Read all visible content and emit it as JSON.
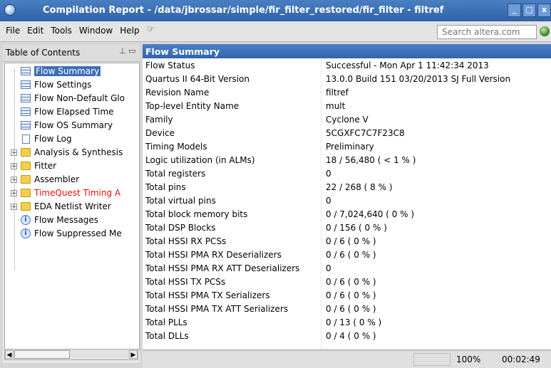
{
  "window": {
    "title": "Compilation Report - /data/jbrossar/simple/fir_filter_restored/fir_filter - filtref",
    "buttons": [
      "minimize",
      "maximize",
      "close"
    ]
  },
  "menubar": {
    "items": [
      "File",
      "Edit",
      "Tools",
      "Window",
      "Help"
    ],
    "search_placeholder": "Search altera.com"
  },
  "toc": {
    "title": "Table of Contents",
    "items": [
      {
        "label": "Flow Summary",
        "icon": "table-icon",
        "selected": true
      },
      {
        "label": "Flow Settings",
        "icon": "table-icon"
      },
      {
        "label": "Flow Non-Default Glo",
        "icon": "table-icon"
      },
      {
        "label": "Flow Elapsed Time",
        "icon": "table-icon"
      },
      {
        "label": "Flow OS Summary",
        "icon": "table-icon"
      },
      {
        "label": "Flow Log",
        "icon": "document-icon"
      },
      {
        "label": "Analysis & Synthesis",
        "icon": "folder-icon",
        "expandable": true
      },
      {
        "label": "Fitter",
        "icon": "folder-icon",
        "expandable": true
      },
      {
        "label": "Assembler",
        "icon": "folder-icon",
        "expandable": true
      },
      {
        "label": "TimeQuest Timing A",
        "icon": "folder-icon",
        "expandable": true,
        "color": "#e01010"
      },
      {
        "label": "EDA Netlist Writer",
        "icon": "folder-icon",
        "expandable": true
      },
      {
        "label": "Flow Messages",
        "icon": "info-icon"
      },
      {
        "label": "Flow Suppressed Me",
        "icon": "info-icon"
      }
    ]
  },
  "report": {
    "title": "Flow Summary",
    "rows": [
      {
        "key": "Flow Status",
        "value": "Successful - Mon Apr  1 11:42:34 2013"
      },
      {
        "key": "Quartus II 64-Bit Version",
        "value": "13.0.0 Build 151 03/20/2013 SJ Full Version"
      },
      {
        "key": "Revision Name",
        "value": "filtref"
      },
      {
        "key": "Top-level Entity Name",
        "value": "mult"
      },
      {
        "key": "Family",
        "value": "Cyclone V"
      },
      {
        "key": "Device",
        "value": "5CGXFC7C7F23C8"
      },
      {
        "key": "Timing Models",
        "value": "Preliminary"
      },
      {
        "key": "Logic utilization (in ALMs)",
        "value": "18 / 56,480 ( < 1 % )"
      },
      {
        "key": "Total registers",
        "value": "0"
      },
      {
        "key": "Total pins",
        "value": "22 / 268 ( 8 % )"
      },
      {
        "key": "Total virtual pins",
        "value": "0"
      },
      {
        "key": "Total block memory bits",
        "value": "0 / 7,024,640 ( 0 % )"
      },
      {
        "key": "Total DSP Blocks",
        "value": "0 / 156 ( 0 % )"
      },
      {
        "key": "Total HSSI RX PCSs",
        "value": "0 / 6 ( 0 % )"
      },
      {
        "key": "Total HSSI PMA RX Deserializers",
        "value": "0 / 6 ( 0 % )"
      },
      {
        "key": "Total HSSI PMA RX ATT Deserializers",
        "value": "0"
      },
      {
        "key": "Total HSSI TX PCSs",
        "value": "0 / 6 ( 0 % )"
      },
      {
        "key": "Total HSSI PMA TX Serializers",
        "value": "0 / 6 ( 0 % )"
      },
      {
        "key": "Total HSSI PMA TX ATT Serializers",
        "value": "0 / 6 ( 0 % )"
      },
      {
        "key": "Total PLLs",
        "value": "0 / 13 ( 0 % )"
      },
      {
        "key": "Total DLLs",
        "value": "0 / 4 ( 0 % )"
      }
    ]
  },
  "status": {
    "zoom": "100%",
    "elapsed": "00:02:49"
  },
  "colors": {
    "title_bar": "#3d6fb8",
    "selection": "#3d6fb8",
    "warning_text": "#e01010"
  }
}
